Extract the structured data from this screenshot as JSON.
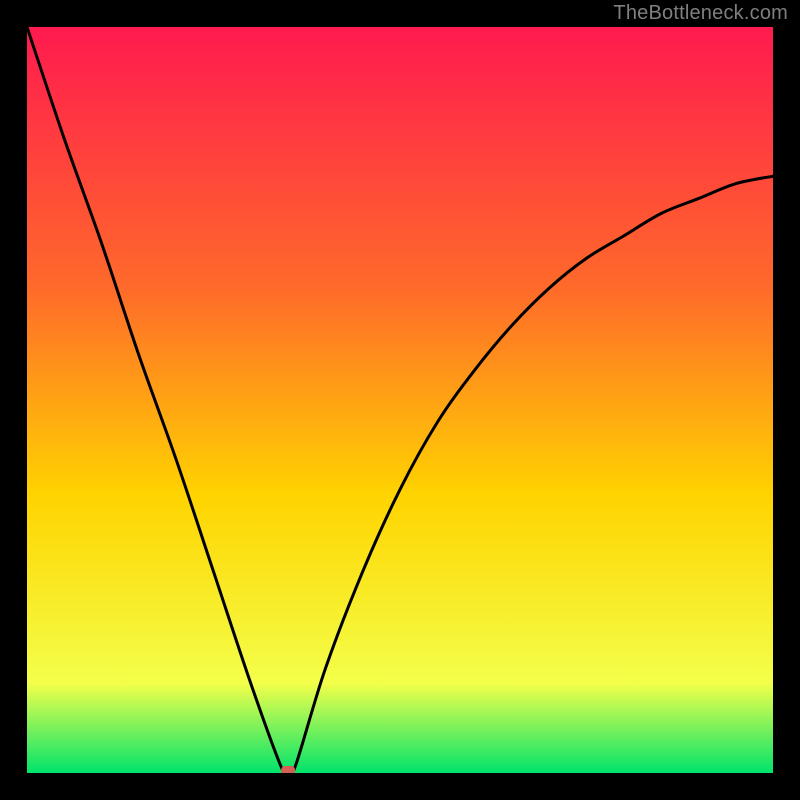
{
  "watermark": "TheBottleneck.com",
  "colors": {
    "frame": "#000000",
    "watermark_text": "#7f7f7f",
    "gradient_top": "#ff1a4f",
    "gradient_mid1": "#ff6a2a",
    "gradient_mid2": "#ffd400",
    "gradient_mid3": "#f3ff4a",
    "gradient_bottom": "#00e36b",
    "curve_stroke": "#000000",
    "marker_fill": "#d55f52"
  },
  "chart_data": {
    "type": "line",
    "title": "",
    "xlabel": "",
    "ylabel": "",
    "xlim": [
      0,
      100
    ],
    "ylim": [
      0,
      100
    ],
    "grid": false,
    "legend": false,
    "series": [
      {
        "name": "bottleneck-curve",
        "x": [
          0,
          5,
          10,
          15,
          20,
          25,
          30,
          34,
          35,
          36,
          40,
          45,
          50,
          55,
          60,
          65,
          70,
          75,
          80,
          85,
          90,
          95,
          100
        ],
        "values": [
          100,
          85,
          71,
          56,
          42,
          27,
          12,
          1,
          0,
          1,
          14,
          27,
          38,
          47,
          54,
          60,
          65,
          69,
          72,
          75,
          77,
          79,
          80
        ]
      }
    ],
    "marker": {
      "x": 35,
      "y": 0
    }
  }
}
